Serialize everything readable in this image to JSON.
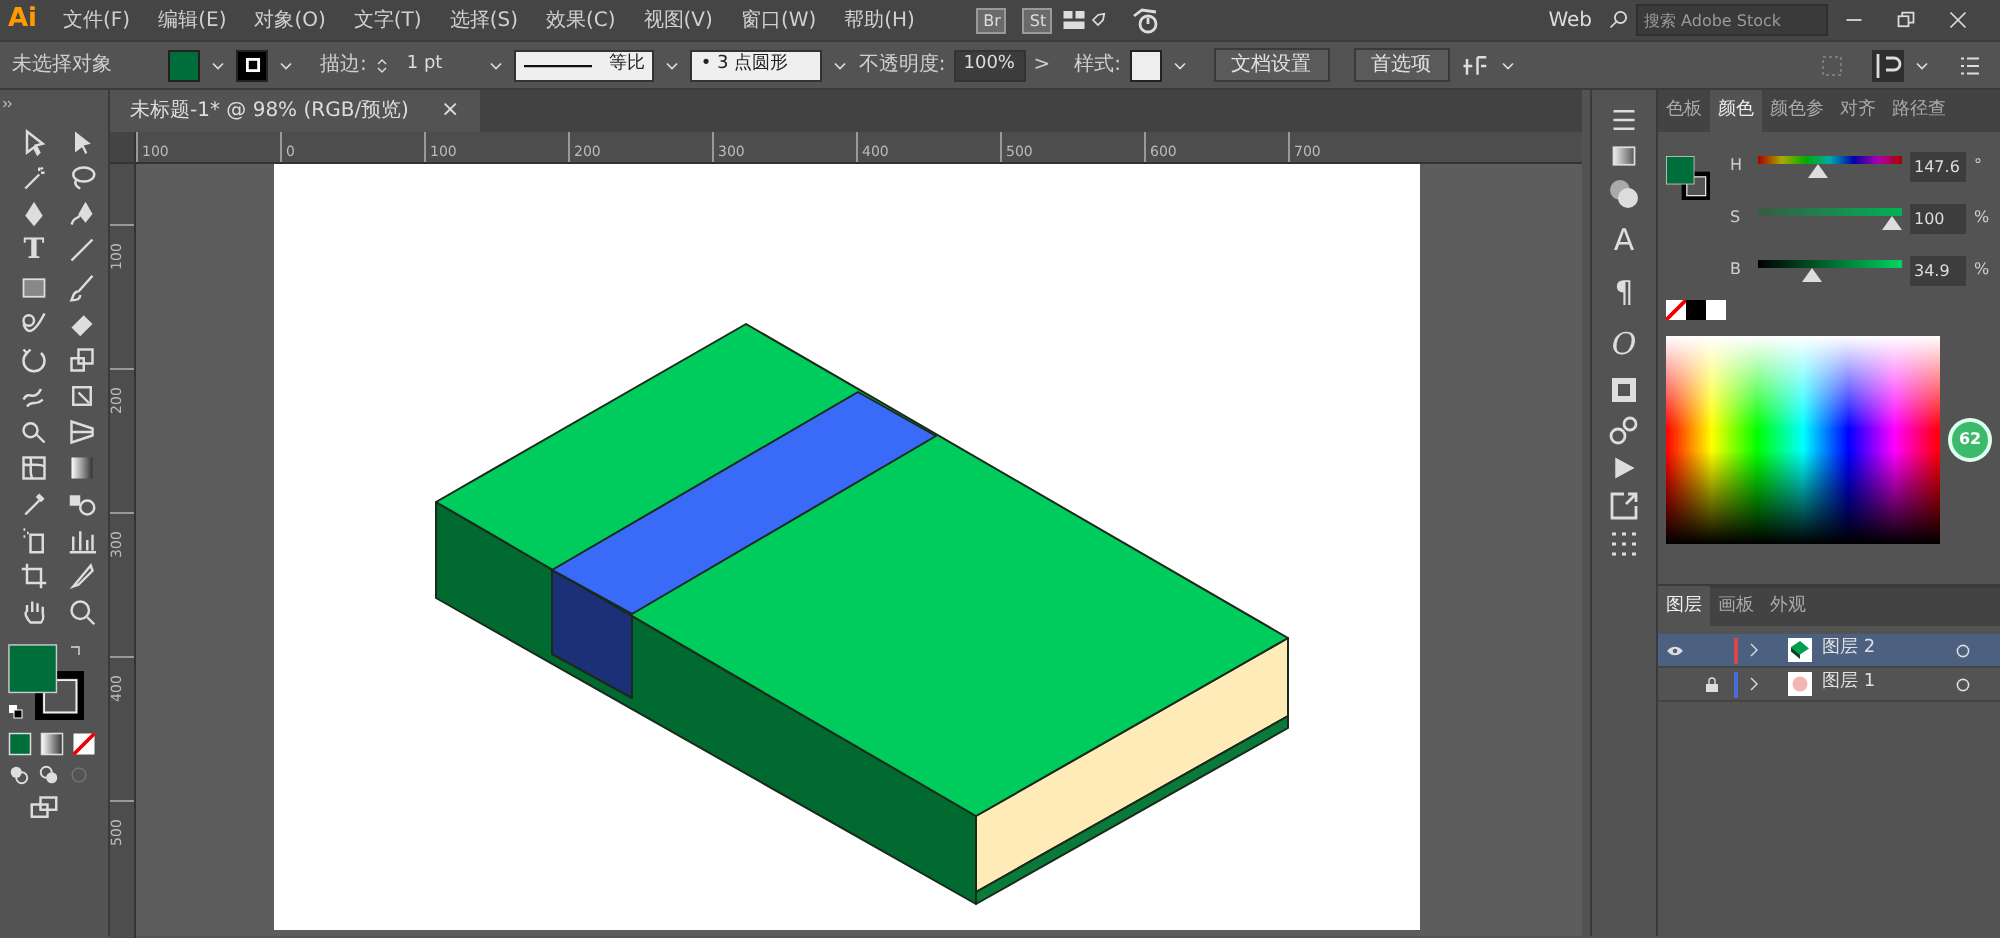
{
  "app_logo": "Ai",
  "menu": [
    "文件(F)",
    "编辑(E)",
    "对象(O)",
    "文字(T)",
    "选择(S)",
    "效果(C)",
    "视图(V)",
    "窗口(W)",
    "帮助(H)"
  ],
  "bridge_buttons": [
    "Br",
    "St"
  ],
  "workspace": {
    "label": "Web"
  },
  "search": {
    "placeholder": "搜索 Adobe Stock"
  },
  "control_bar": {
    "selection": "未选择对象",
    "stroke_label": "描边:",
    "stroke_weight": "1 pt",
    "profile_label": "等比",
    "brush": "• 3 点圆形",
    "opacity_label": "不透明度:",
    "opacity": "100%",
    "more": ">",
    "style_label": "样式:",
    "buttons": [
      "文档设置",
      "首选项"
    ]
  },
  "document_tab": {
    "title": "未标题-1* @ 98% (RGB/预览)",
    "close": "×"
  },
  "ruler": {
    "horizontal": [
      "100",
      "0",
      "100",
      "200",
      "300",
      "400",
      "500",
      "600",
      "700"
    ],
    "vertical": [
      "100",
      "200",
      "300",
      "400",
      "500"
    ]
  },
  "type_tool_glyph": "T",
  "dock_glyphs": [
    "A",
    "¶",
    "O"
  ],
  "color_panel": {
    "tabs": [
      {
        "label": "色板",
        "selected": false
      },
      {
        "label": "颜色",
        "selected": true
      },
      {
        "label": "颜色参",
        "selected": false
      },
      {
        "label": "对齐",
        "selected": false
      },
      {
        "label": "路径查",
        "selected": false
      }
    ],
    "sliders": [
      {
        "label": "H",
        "kind": "hue",
        "level": 0.41,
        "value": "147.6",
        "unit": "°"
      },
      {
        "label": "S",
        "kind": "saturation",
        "level": 1.0,
        "value": "100",
        "unit": "%"
      },
      {
        "label": "B",
        "kind": "brightness",
        "level": 0.349,
        "value": "34.9",
        "unit": "%"
      }
    ]
  },
  "layers_panel": {
    "tabs": [
      {
        "label": "图层",
        "selected": true
      },
      {
        "label": "画板",
        "selected": false
      },
      {
        "label": "外观",
        "selected": false
      }
    ],
    "layers": [
      {
        "name": "图层 2",
        "visible": true,
        "locked": false,
        "selected": true,
        "color": "#d84a4a",
        "kind": "artwork"
      },
      {
        "name": "图层 1",
        "visible": false,
        "locked": true,
        "selected": false,
        "color": "#4a6cd8",
        "kind": "plain"
      }
    ]
  },
  "badge": "62"
}
